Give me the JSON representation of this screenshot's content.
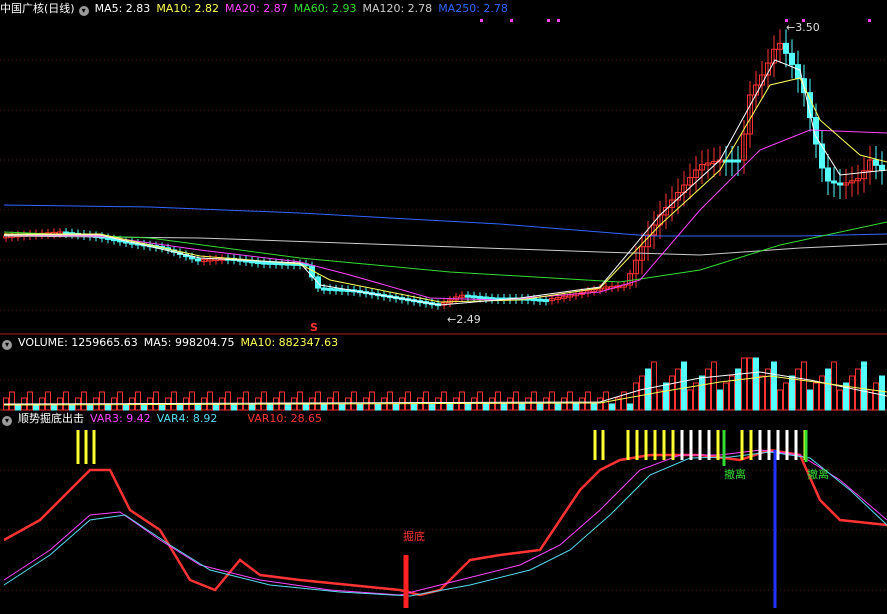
{
  "price_panel": {
    "title": "中国广核(日线)",
    "indicators": [
      {
        "label": "MA5: 2.83",
        "color": "#ffffff"
      },
      {
        "label": "MA10: 2.82",
        "color": "#ffff55"
      },
      {
        "label": "MA20: 2.87",
        "color": "#ff44ff"
      },
      {
        "label": "MA60: 2.93",
        "color": "#33dd33"
      },
      {
        "label": "MA120: 2.78",
        "color": "#cccccc"
      },
      {
        "label": "MA250: 2.78",
        "color": "#3366ff"
      }
    ],
    "high_label": "3.50",
    "low_label": "2.49",
    "signal_mark": "S"
  },
  "volume_panel": {
    "title": "VOLUME: 1259665.63",
    "ma5": "MA5: 998204.75",
    "ma10": "MA10: 882347.63",
    "colors": {
      "ma5": "#ffffff",
      "ma10": "#ffff55"
    }
  },
  "indicator_panel": {
    "title": "顺势掘底出击",
    "var3": "VAR3: 9.42",
    "var4": "VAR4: 8.92",
    "var10": "VAR10: 28.65",
    "colors": {
      "var3": "#ff44ff",
      "var4": "#55ddee",
      "var10": "#ff3333"
    },
    "label_bottom": "掘底",
    "label_exit": "撤离"
  },
  "icons": {
    "collapse": "chevron-down-icon"
  },
  "colors": {
    "up": "#ff3333",
    "down": "#55ffff",
    "bg": "#000000",
    "frame": "#aa2222"
  }
}
